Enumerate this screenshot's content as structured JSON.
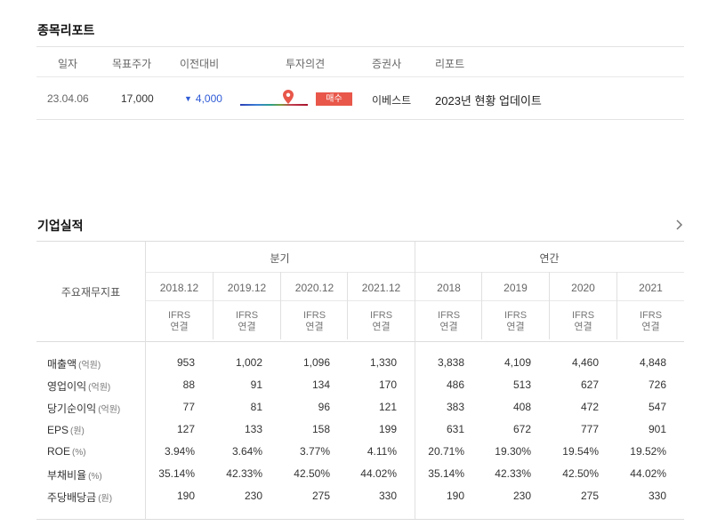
{
  "report_section": {
    "title": "종목리포트",
    "headers": [
      "일자",
      "목표주가",
      "이전대비",
      "투자의견",
      "증권사",
      "리포트"
    ],
    "row": {
      "date": "23.04.06",
      "target_price": "17,000",
      "diff": "4,000",
      "diff_direction": "down",
      "opinion": "매수",
      "broker": "이베스트",
      "report_title": "2023년 현황 업데이트"
    }
  },
  "perf_section": {
    "title": "기업실적",
    "key_indicator_label": "주요재무지표",
    "quarter_label": "분기",
    "annual_label": "연간",
    "quarter_periods": [
      "2018.12",
      "2019.12",
      "2020.12",
      "2021.12"
    ],
    "annual_periods": [
      "2018",
      "2019",
      "2020",
      "2021"
    ],
    "ifrs_line1": "IFRS",
    "ifrs_line2": "연결",
    "rows": [
      {
        "name": "매출액",
        "unit": "(억원)",
        "values": [
          "953",
          "1,002",
          "1,096",
          "1,330",
          "3,838",
          "4,109",
          "4,460",
          "4,848"
        ]
      },
      {
        "name": "영업이익",
        "unit": "(억원)",
        "values": [
          "88",
          "91",
          "134",
          "170",
          "486",
          "513",
          "627",
          "726"
        ]
      },
      {
        "name": "당기순이익",
        "unit": "(억원)",
        "values": [
          "77",
          "81",
          "96",
          "121",
          "383",
          "408",
          "472",
          "547"
        ]
      },
      {
        "name": "EPS",
        "unit": "(원)",
        "values": [
          "127",
          "133",
          "158",
          "199",
          "631",
          "672",
          "777",
          "901"
        ]
      },
      {
        "name": "ROE",
        "unit": "(%)",
        "values": [
          "3.94%",
          "3.64%",
          "3.77%",
          "4.11%",
          "20.71%",
          "19.30%",
          "19.54%",
          "19.52%"
        ]
      },
      {
        "name": "부채비율",
        "unit": "(%)",
        "values": [
          "35.14%",
          "42.33%",
          "42.50%",
          "44.02%",
          "35.14%",
          "42.33%",
          "42.50%",
          "44.02%"
        ]
      },
      {
        "name": "주당배당금",
        "unit": "(원)",
        "values": [
          "190",
          "230",
          "275",
          "330",
          "190",
          "230",
          "275",
          "330"
        ]
      }
    ]
  },
  "colors": {
    "down": "#2f5bd6",
    "badge": "#e8574a"
  },
  "icons": {
    "pin": "map-pin-icon",
    "more": "chevron-right-icon",
    "down": "triangle-down-icon"
  }
}
